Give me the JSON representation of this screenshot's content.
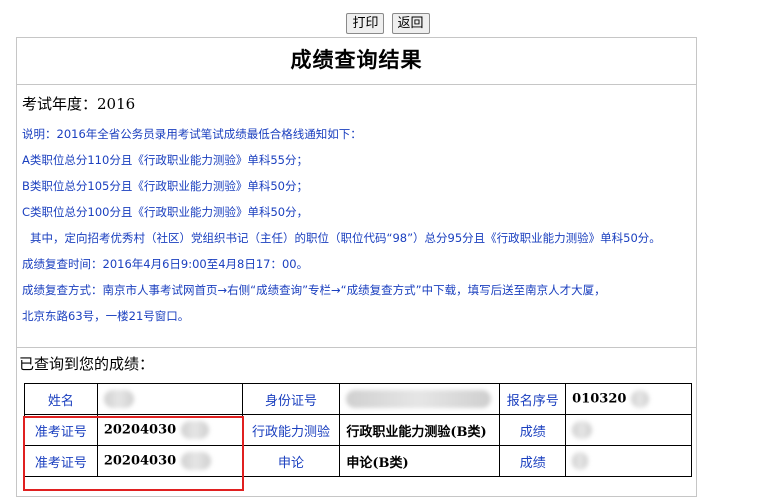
{
  "toolbar": {
    "print_label": "打印",
    "back_label": "返回"
  },
  "page_title": "成绩查询结果",
  "exam_year": "考试年度：2016",
  "notes": [
    "说明：2016年全省公务员录用考试笔试成绩最低合格线通知如下：",
    "A类职位总分110分且《行政职业能力测验》单科55分；",
    "B类职位总分105分且《行政职业能力测验》单科50分；",
    "C类职位总分100分且《行政职业能力测验》单科50分，",
    "其中，定向招考优秀村（社区）党组织书记（主任）的职位（职位代码“98”）总分95分且《行政职业能力测验》单科50分。",
    "成绩复查时间：2016年4月6日9:00至4月8日17：00。",
    "成绩复查方式：南京市人事考试网首页→右侧“成绩查询”专栏→“成绩复查方式”中下载，填写后送至南京人才大厦，",
    "北京东路63号，一楼21号窗口。"
  ],
  "queried_label": "已查询到您的成绩：",
  "table": {
    "row1": {
      "name_label": "姓名",
      "id_label": "身份证号",
      "reg_label": "报名序号",
      "reg_value": "010320"
    },
    "row2": {
      "ticket_label": "准考证号",
      "ticket_value": "20204030",
      "subject_label": "行政能力测验",
      "subject_value": "行政职业能力测验(B类)",
      "score_label": "成绩"
    },
    "row3": {
      "ticket_label": "准考证号",
      "ticket_value": "20204030",
      "subject_label": "申论",
      "subject_value": "申论(B类)",
      "score_label": "成绩"
    }
  },
  "colors": {
    "note_text": "#1a3fbf",
    "highlight": "#e02020"
  }
}
